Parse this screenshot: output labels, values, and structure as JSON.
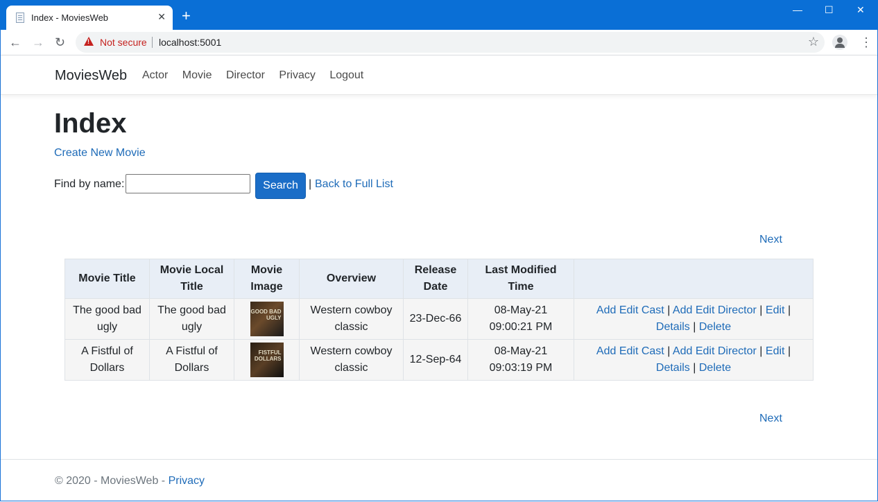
{
  "browser": {
    "tab_title": "Index - MoviesWeb",
    "tab_close": "✕",
    "new_tab": "+",
    "min": "—",
    "max": "☐",
    "close": "✕",
    "security_label": "Not secure",
    "url": "localhost:5001"
  },
  "nav": {
    "brand": "MoviesWeb",
    "links": [
      "Actor",
      "Movie",
      "Director",
      "Privacy",
      "Logout"
    ]
  },
  "page": {
    "title": "Index",
    "create_link": "Create New Movie",
    "find_label": "Find by name:",
    "search_button": "Search",
    "pipe": "|",
    "back_link": "Back to Full List",
    "next_top": "Next",
    "next_bottom": "Next"
  },
  "table": {
    "headers": [
      "Movie Title",
      "Movie Local Title",
      "Movie Image",
      "Overview",
      "Release Date",
      "Last Modified Time",
      ""
    ],
    "rows": [
      {
        "title": "The good bad ugly",
        "local_title": "The good bad ugly",
        "image_text": "GOOD BAD UGLY",
        "overview": "Western cowboy classic",
        "release": "23-Dec-66",
        "modified": "08-May-21 09:00:21 PM"
      },
      {
        "title": "A Fistful of Dollars",
        "local_title": "A Fistful of Dollars",
        "image_text": "FISTFUL DOLLARS",
        "overview": "Western cowboy classic",
        "release": "12-Sep-64",
        "modified": "08-May-21 09:03:19 PM"
      }
    ],
    "actions": {
      "add_cast": "Add Edit Cast",
      "add_director": "Add Edit Director",
      "edit": "Edit",
      "details": "Details",
      "delete": "Delete",
      "sep": "|"
    }
  },
  "footer": {
    "copyright": "© 2020 - MoviesWeb - ",
    "privacy": "Privacy"
  }
}
